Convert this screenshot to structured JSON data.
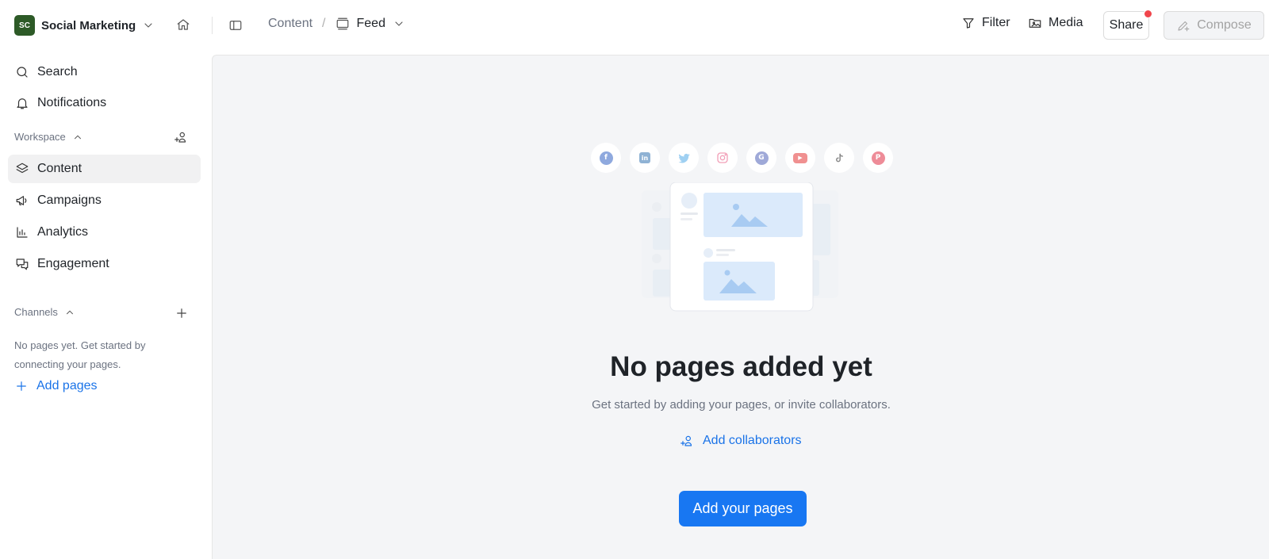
{
  "workspace": {
    "initials": "SC",
    "name": "Social Marketing",
    "logo_color": "#2d5a27"
  },
  "breadcrumb": {
    "root": "Content",
    "separator": "/",
    "current": "Feed"
  },
  "toolbar": {
    "filter_label": "Filter",
    "media_label": "Media",
    "share_label": "Share",
    "compose_label": "Compose"
  },
  "sidebar": {
    "search_label": "Search",
    "notifications_label": "Notifications",
    "workspace_section": "Workspace",
    "items": [
      {
        "label": "Content",
        "icon": "layers-icon",
        "active": true
      },
      {
        "label": "Campaigns",
        "icon": "megaphone-icon",
        "active": false
      },
      {
        "label": "Analytics",
        "icon": "bar-chart-icon",
        "active": false
      },
      {
        "label": "Engagement",
        "icon": "chat-bubbles-icon",
        "active": false
      }
    ],
    "channels_section": "Channels",
    "channels_empty": "No pages yet. Get started by connecting your pages.",
    "add_pages": "Add pages"
  },
  "main": {
    "social_icons": [
      "facebook-icon",
      "linkedin-icon",
      "twitter-icon",
      "instagram-icon",
      "google-icon",
      "youtube-icon",
      "tiktok-icon",
      "pinterest-icon"
    ],
    "empty_title": "No pages added yet",
    "empty_subtitle": "Get started by adding your pages, or invite collaborators.",
    "collab_link": "Add collaborators",
    "primary_button": "Add your pages"
  },
  "colors": {
    "accent": "#1877f2",
    "link": "#1a73e8",
    "notification_dot": "#f0454b"
  }
}
